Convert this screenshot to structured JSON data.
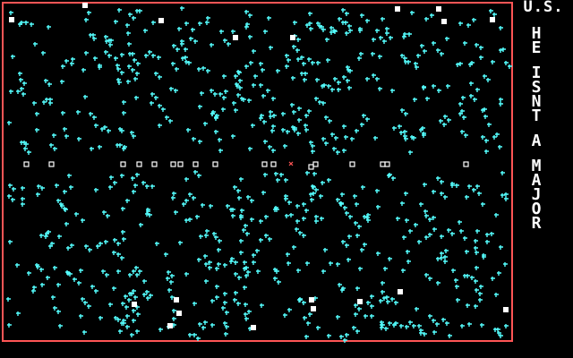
{
  "colors": {
    "background": "#000000",
    "border": "#ff5555",
    "plant": "#55ffff",
    "block": "#ffffff",
    "marker": "#ff5555",
    "text": "#ffffff"
  },
  "sidebar": {
    "title": "U.S.",
    "message": "HE ISNT A MAJOR"
  },
  "map": {
    "field_seed": 73,
    "field_count": 820,
    "mine_markers": 1
  }
}
